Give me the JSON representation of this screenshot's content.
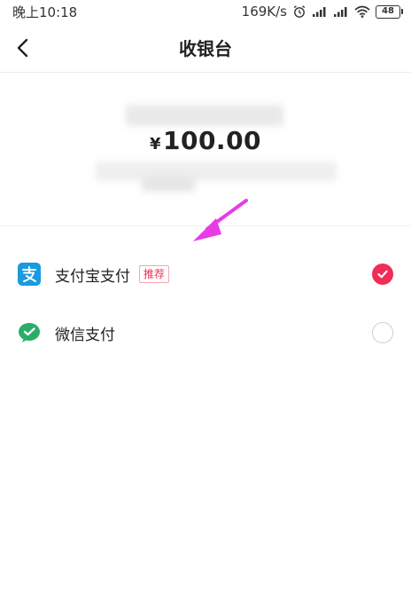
{
  "status_bar": {
    "time": "晚上10:18",
    "network_speed": "169K/s",
    "battery_level": "48",
    "icons": [
      "alarm-icon",
      "signal-icon",
      "signal-icon",
      "wifi-icon",
      "battery-icon"
    ]
  },
  "header": {
    "title": "收银台",
    "back_icon": "back-arrow-icon"
  },
  "amount": {
    "currency": "¥",
    "value": "100.00"
  },
  "payment_options": [
    {
      "label": "支付宝支付",
      "badge": "推荐",
      "icon": "alipay-icon",
      "selected": true
    },
    {
      "label": "微信支付",
      "icon": "wechat-icon",
      "selected": false
    }
  ],
  "colors": {
    "accent": "#f02d57",
    "alipay_blue": "#1a9ae0",
    "wechat_green": "#2aae67",
    "annotation_arrow": "#e83be6"
  }
}
